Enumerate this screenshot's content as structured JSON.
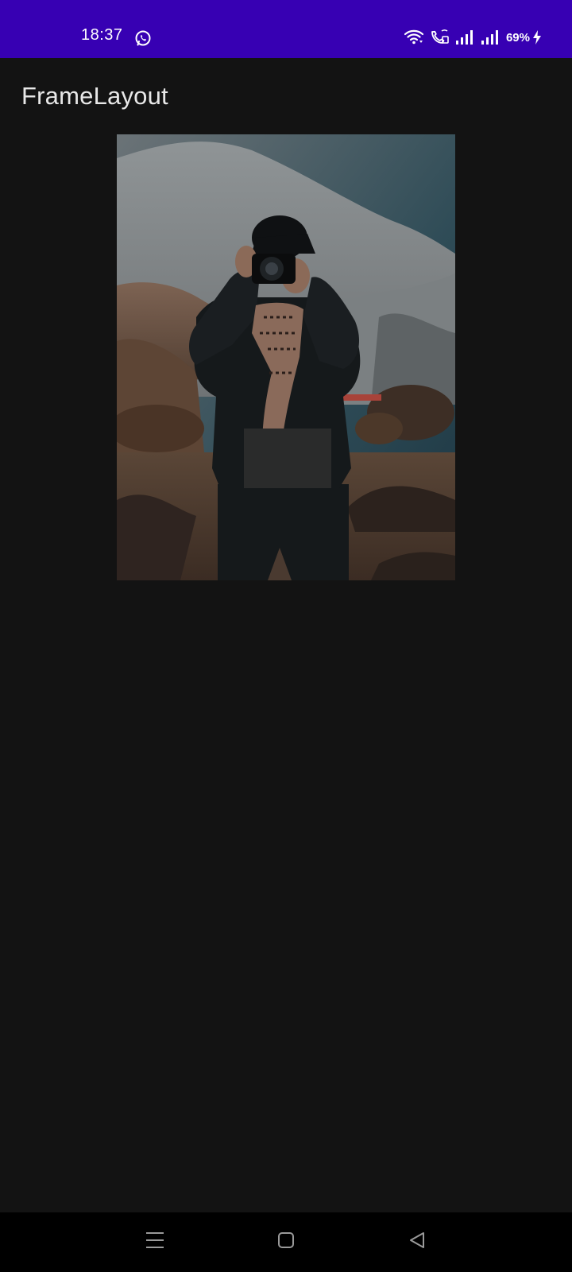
{
  "status_bar": {
    "time": "18:37",
    "battery": "69%",
    "icons": [
      "whatsapp-icon",
      "wifi-icon",
      "wifi-calling-icon",
      "signal-icon",
      "signal-icon",
      "charging-icon"
    ],
    "background": "#3700b3"
  },
  "app_bar": {
    "title": "FrameLayout"
  },
  "content": {
    "image": "photographer-with-camera-mountains"
  },
  "nav_bar": {
    "buttons": [
      "menu-icon",
      "home-icon",
      "back-icon"
    ]
  },
  "colors": {
    "background": "#131313",
    "status_bar": "#3700b3",
    "nav_bar": "#000000",
    "title_text": "#e8e8e8"
  }
}
